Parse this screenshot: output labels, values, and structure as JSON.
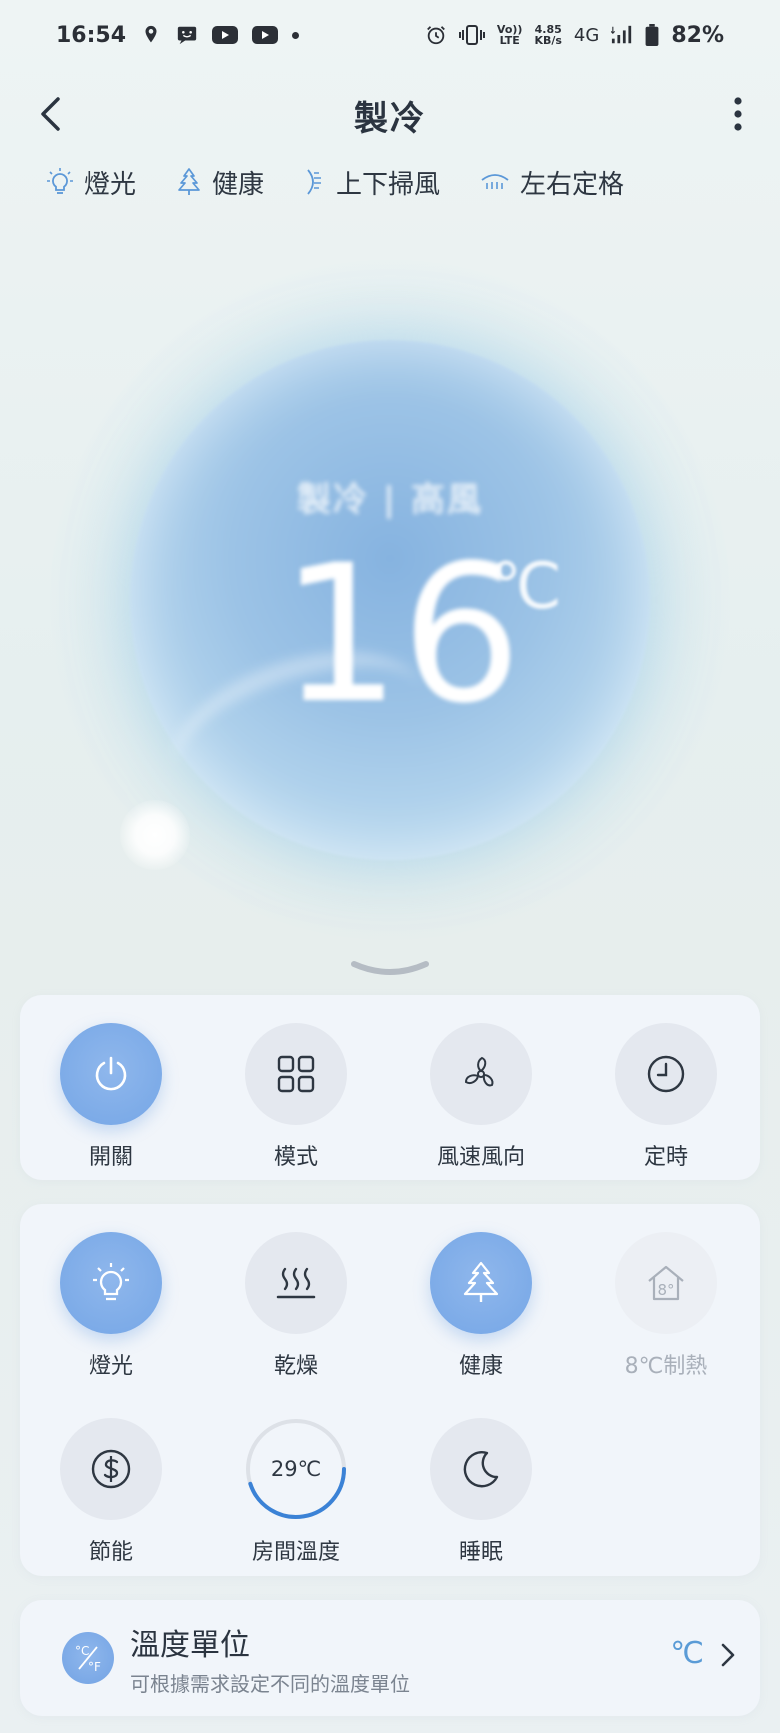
{
  "status_bar": {
    "time": "16:54",
    "speed_top": "4.85",
    "speed_bottom": "KB/s",
    "volte_top": "Vo))",
    "volte_bottom": "LTE",
    "network": "4G",
    "battery": "82%"
  },
  "header": {
    "title": "製冷"
  },
  "features": [
    {
      "label": "燈光",
      "icon": "bulb-icon"
    },
    {
      "label": "健康",
      "icon": "tree-icon"
    },
    {
      "label": "上下掃風",
      "icon": "vertical-swing-icon"
    },
    {
      "label": "左右定格",
      "icon": "horizontal-fixed-icon"
    }
  ],
  "display": {
    "status": "製冷 | 高風",
    "temperature": "16",
    "unit": "℃"
  },
  "controls_primary": [
    {
      "label": "開關",
      "icon": "power-icon",
      "active": true
    },
    {
      "label": "模式",
      "icon": "grid-icon",
      "active": false
    },
    {
      "label": "風速風向",
      "icon": "fan-icon",
      "active": false
    },
    {
      "label": "定時",
      "icon": "clock-icon",
      "active": false
    }
  ],
  "controls_secondary": [
    {
      "label": "燈光",
      "icon": "bulb-icon",
      "active": true
    },
    {
      "label": "乾燥",
      "icon": "heat-icon",
      "active": false
    },
    {
      "label": "健康",
      "icon": "tree-icon",
      "active": true
    },
    {
      "label": "8℃制熱",
      "icon": "house-8-icon",
      "active": false,
      "disabled": true
    },
    {
      "label": "節能",
      "icon": "dollar-icon",
      "active": false
    },
    {
      "label": "房間溫度",
      "value": "29℃",
      "progress": 0.45
    },
    {
      "label": "睡眠",
      "icon": "moon-icon",
      "active": false
    }
  ],
  "unit_setting": {
    "title": "溫度單位",
    "subtitle": "可根據需求設定不同的溫度單位",
    "value": "℃",
    "icon": "celsius-fahrenheit-icon"
  },
  "colors": {
    "accent": "#75a6e6",
    "value_blue": "#5a9bd6",
    "ring_blue": "#3b82d6"
  }
}
